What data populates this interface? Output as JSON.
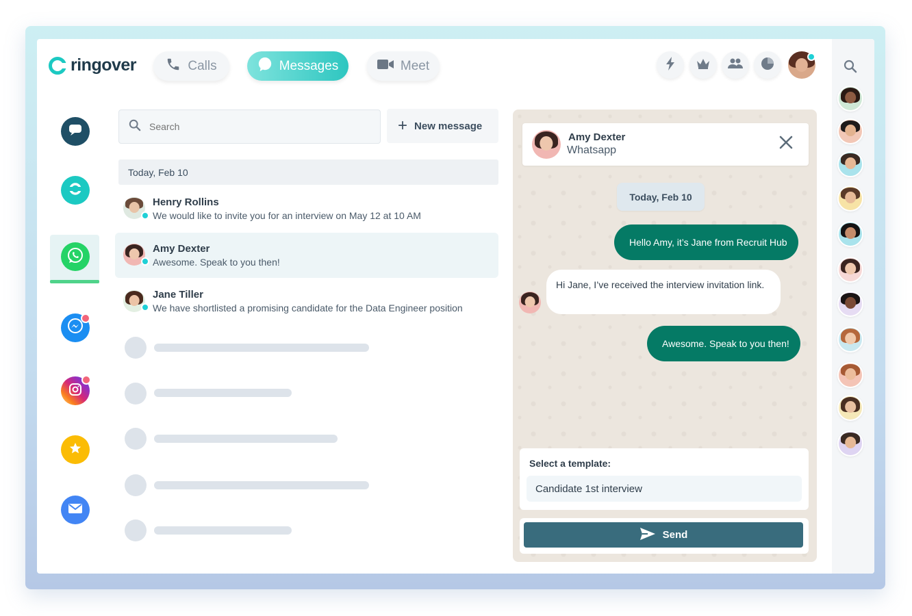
{
  "app": {
    "brand": "ringover"
  },
  "tabs": [
    {
      "label": "Calls",
      "icon": "phone-icon",
      "active": false
    },
    {
      "label": "Messages",
      "icon": "chat-bubble-icon",
      "active": true
    },
    {
      "label": "Meet",
      "icon": "video-camera-icon",
      "active": false
    }
  ],
  "header_buttons": [
    "lightning-icon",
    "crown-icon",
    "people-icon",
    "pie-chart-icon"
  ],
  "left_rail": [
    {
      "icon": "sms-chat-icon",
      "color": "#1f4f66"
    },
    {
      "icon": "ringover-icon",
      "color": "#1cc9c2"
    },
    {
      "icon": "whatsapp-icon",
      "color": "#25d366",
      "active": true
    },
    {
      "icon": "messenger-icon",
      "color": "#1b8ef2",
      "badge": true
    },
    {
      "icon": "instagram-icon",
      "color": "#c837ab",
      "badge": true
    },
    {
      "icon": "star-icon",
      "color": "#fbbc05"
    },
    {
      "icon": "mail-icon",
      "color": "#4285f4"
    }
  ],
  "search": {
    "placeholder": "Search"
  },
  "new_message": {
    "label": "New message"
  },
  "conversations": {
    "day": "Today, Feb 10",
    "items": [
      {
        "name": "Henry Rollins",
        "preview": "We would like to invite you for an interview on May 12 at 10 AM"
      },
      {
        "name": "Amy Dexter",
        "preview": "Awesome. Speak to you then!",
        "selected": true
      },
      {
        "name": "Jane Tiller",
        "preview": "We have shortlisted a promising candidate for the Data Engineer position"
      }
    ]
  },
  "chat": {
    "contact_name": "Amy Dexter",
    "channel": "Whatsapp",
    "date": "Today, Feb 10",
    "messages": [
      {
        "dir": "out",
        "text": "Hello Amy, it’s Jane from Recruit Hub"
      },
      {
        "dir": "in",
        "text": "Hi Jane, I’ve received the interview invitation link."
      },
      {
        "dir": "out",
        "text": "Awesome. Speak to you then!"
      }
    ],
    "template_label": "Select a template:",
    "template_value": "Candidate 1st interview",
    "send_label": "Send"
  },
  "colors": {
    "accent": "#1cc9c2",
    "whatsapp_bubble": "#057a65",
    "send_button": "#396c7d"
  }
}
